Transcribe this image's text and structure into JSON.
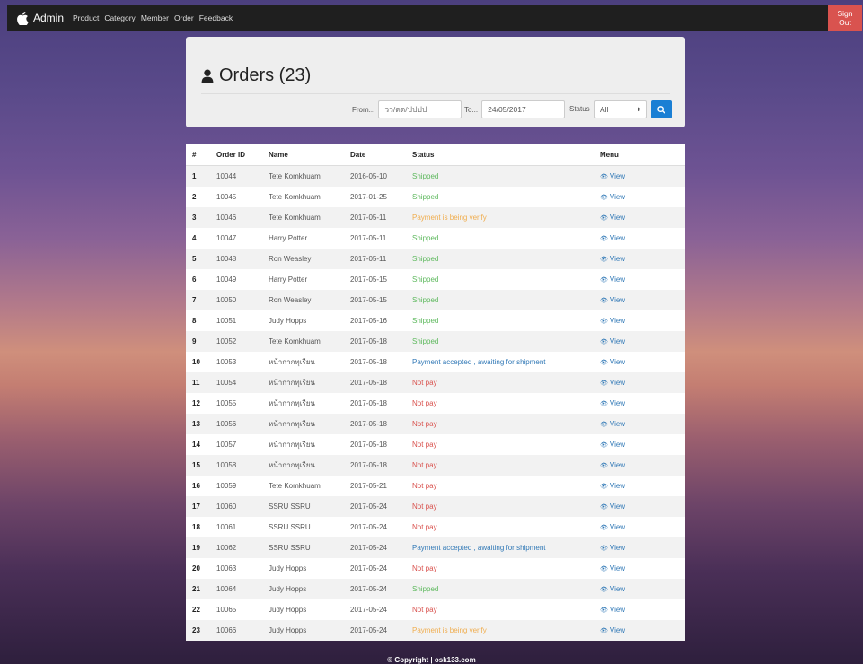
{
  "nav": {
    "brand": "Admin",
    "links": [
      "Product",
      "Category",
      "Member",
      "Order",
      "Feedback"
    ],
    "signout": "Sign Out"
  },
  "page": {
    "title": "Orders (23)"
  },
  "filter": {
    "from_label": "From...",
    "from_placeholder": "วว/ดด/ปปปป",
    "to_label": "To...",
    "to_value": "24/05/2017",
    "status_label": "Status",
    "status_value": "All"
  },
  "table": {
    "headers": [
      "#",
      "Order ID",
      "Name",
      "Date",
      "Status",
      "Menu"
    ],
    "view_label": "View",
    "rows": [
      {
        "n": "1",
        "id": "10044",
        "name": "Tete Komkhuam",
        "date": "2016-05-10",
        "status": "Shipped",
        "kind": "shipped"
      },
      {
        "n": "2",
        "id": "10045",
        "name": "Tete Komkhuam",
        "date": "2017-01-25",
        "status": "Shipped",
        "kind": "shipped"
      },
      {
        "n": "3",
        "id": "10046",
        "name": "Tete Komkhuam",
        "date": "2017-05-11",
        "status": "Payment is being verify",
        "kind": "verify"
      },
      {
        "n": "4",
        "id": "10047",
        "name": "Harry Potter",
        "date": "2017-05-11",
        "status": "Shipped",
        "kind": "shipped"
      },
      {
        "n": "5",
        "id": "10048",
        "name": "Ron Weasley",
        "date": "2017-05-11",
        "status": "Shipped",
        "kind": "shipped"
      },
      {
        "n": "6",
        "id": "10049",
        "name": "Harry Potter",
        "date": "2017-05-15",
        "status": "Shipped",
        "kind": "shipped"
      },
      {
        "n": "7",
        "id": "10050",
        "name": "Ron Weasley",
        "date": "2017-05-15",
        "status": "Shipped",
        "kind": "shipped"
      },
      {
        "n": "8",
        "id": "10051",
        "name": "Judy Hopps",
        "date": "2017-05-16",
        "status": "Shipped",
        "kind": "shipped"
      },
      {
        "n": "9",
        "id": "10052",
        "name": "Tete Komkhuam",
        "date": "2017-05-18",
        "status": "Shipped",
        "kind": "shipped"
      },
      {
        "n": "10",
        "id": "10053",
        "name": "หน้ากากทุเรียน",
        "date": "2017-05-18",
        "status": "Payment accepted , awaiting for shipment",
        "kind": "accepted"
      },
      {
        "n": "11",
        "id": "10054",
        "name": "หน้ากากทุเรียน",
        "date": "2017-05-18",
        "status": "Not pay",
        "kind": "notpay"
      },
      {
        "n": "12",
        "id": "10055",
        "name": "หน้ากากทุเรียน",
        "date": "2017-05-18",
        "status": "Not pay",
        "kind": "notpay"
      },
      {
        "n": "13",
        "id": "10056",
        "name": "หน้ากากทุเรียน",
        "date": "2017-05-18",
        "status": "Not pay",
        "kind": "notpay"
      },
      {
        "n": "14",
        "id": "10057",
        "name": "หน้ากากทุเรียน",
        "date": "2017-05-18",
        "status": "Not pay",
        "kind": "notpay"
      },
      {
        "n": "15",
        "id": "10058",
        "name": "หน้ากากทุเรียน",
        "date": "2017-05-18",
        "status": "Not pay",
        "kind": "notpay"
      },
      {
        "n": "16",
        "id": "10059",
        "name": "Tete Komkhuam",
        "date": "2017-05-21",
        "status": "Not pay",
        "kind": "notpay"
      },
      {
        "n": "17",
        "id": "10060",
        "name": "SSRU SSRU",
        "date": "2017-05-24",
        "status": "Not pay",
        "kind": "notpay"
      },
      {
        "n": "18",
        "id": "10061",
        "name": "SSRU SSRU",
        "date": "2017-05-24",
        "status": "Not pay",
        "kind": "notpay"
      },
      {
        "n": "19",
        "id": "10062",
        "name": "SSRU SSRU",
        "date": "2017-05-24",
        "status": "Payment accepted , awaiting for shipment",
        "kind": "accepted"
      },
      {
        "n": "20",
        "id": "10063",
        "name": "Judy Hopps",
        "date": "2017-05-24",
        "status": "Not pay",
        "kind": "notpay"
      },
      {
        "n": "21",
        "id": "10064",
        "name": "Judy Hopps",
        "date": "2017-05-24",
        "status": "Shipped",
        "kind": "shipped"
      },
      {
        "n": "22",
        "id": "10065",
        "name": "Judy Hopps",
        "date": "2017-05-24",
        "status": "Not pay",
        "kind": "notpay"
      },
      {
        "n": "23",
        "id": "10066",
        "name": "Judy Hopps",
        "date": "2017-05-24",
        "status": "Payment is being verify",
        "kind": "verify"
      }
    ]
  },
  "footer": {
    "text": "© Copyright | osk133.com"
  }
}
